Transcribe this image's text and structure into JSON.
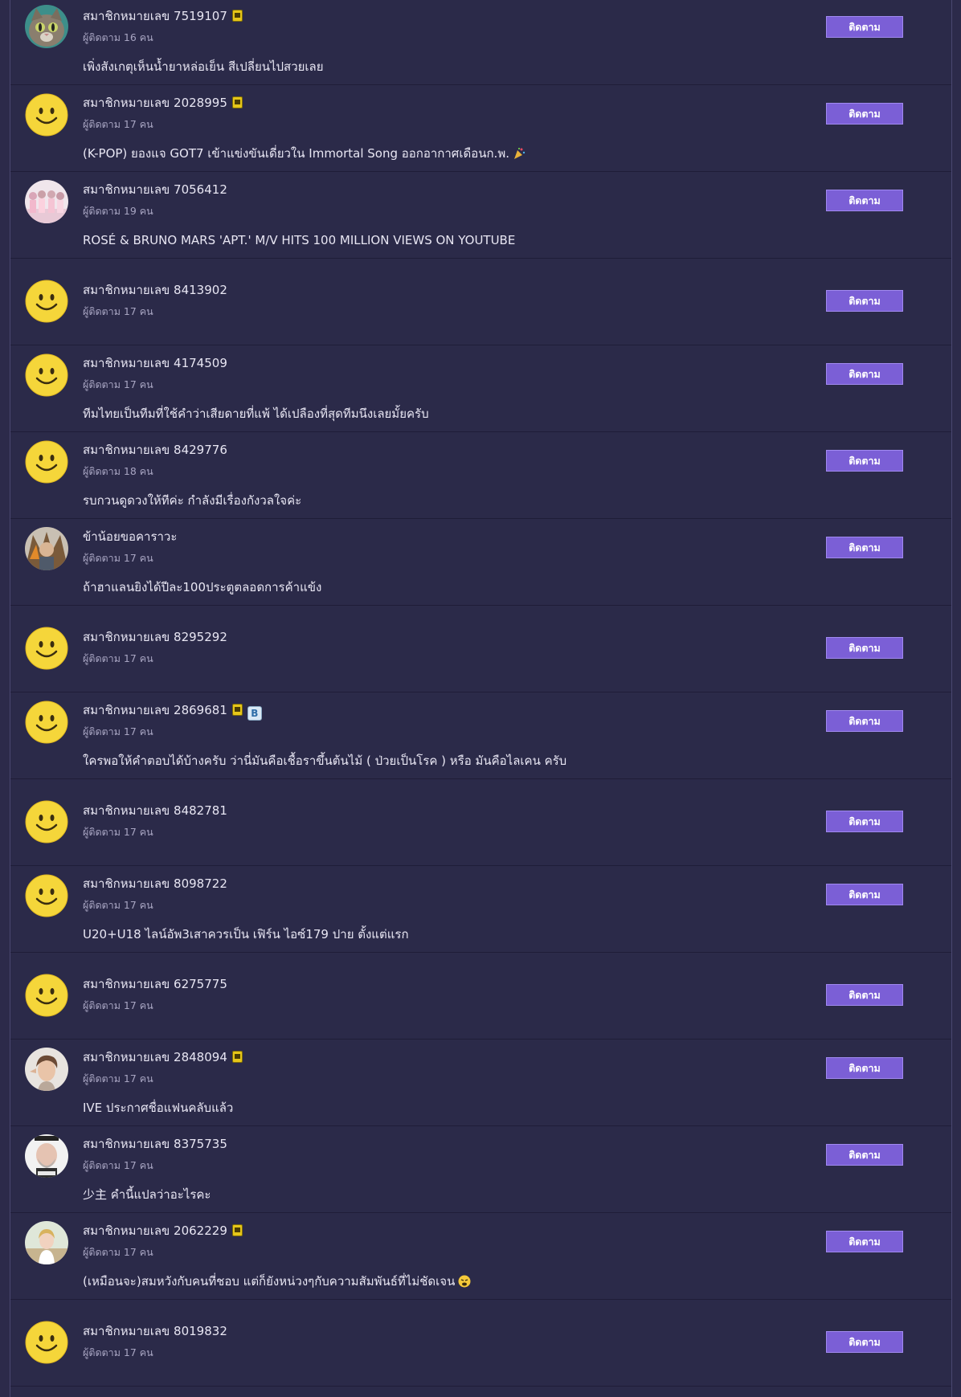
{
  "follow_label": "ติดตาม",
  "members": [
    {
      "name": "สมาชิกหมายเลข 7519107",
      "followers": "ผู้ติดตาม 16 คน",
      "post": "เพิ่งสังเกตุเห็นน้ำยาหล่อเย็น สีเปลี่ยนไปสวยเลย",
      "avatar": "cat-avatar",
      "badges": [
        "phone-badge"
      ]
    },
    {
      "name": "สมาชิกหมายเลข 2028995",
      "followers": "ผู้ติดตาม 17 คน",
      "post": "(K-POP) ยองแจ GOT7 เข้าแข่งขันเดี่ยวใน Immortal Song ออกอากาศเดือนก.พ.",
      "post_emoji": "party-popper",
      "avatar": "smiley-avatar",
      "badges": [
        "phone-badge"
      ]
    },
    {
      "name": "สมาชิกหมายเลข 7056412",
      "followers": "ผู้ติดตาม 19 คน",
      "post": "ROSÉ & BRUNO MARS 'APT.' M/V HITS 100 MILLION VIEWS ON YOUTUBE",
      "avatar": "group-photo-avatar",
      "badges": []
    },
    {
      "name": "สมาชิกหมายเลข 8413902",
      "followers": "ผู้ติดตาม 17 คน",
      "post": "",
      "avatar": "smiley-avatar",
      "badges": []
    },
    {
      "name": "สมาชิกหมายเลข 4174509",
      "followers": "ผู้ติดตาม 17 คน",
      "post": "ทีมไทยเป็นทีมที่ใช้คำว่าเสียดายที่แพ้ ได้เปลืองที่สุดทีมนึงเลยมั้ยครับ",
      "avatar": "smiley-avatar",
      "badges": []
    },
    {
      "name": "สมาชิกหมายเลข 8429776",
      "followers": "ผู้ติดตาม 18 คน",
      "post": "รบกวนดูดวงให้ทีค่ะ กำลังมีเรื่องกังวลใจค่ะ",
      "avatar": "smiley-avatar",
      "badges": []
    },
    {
      "name": "ข้าน้อยขอคาราวะ",
      "followers": "ผู้ติดตาม 17 คน",
      "post": "ถ้าฮาแลนยิงได้ปีละ100ประตูตลอดการค้าแข้ง",
      "avatar": "warrior-avatar",
      "badges": []
    },
    {
      "name": "สมาชิกหมายเลข 8295292",
      "followers": "ผู้ติดตาม 17 คน",
      "post": "",
      "avatar": "smiley-avatar",
      "badges": []
    },
    {
      "name": "สมาชิกหมายเลข 2869681",
      "followers": "ผู้ติดตาม 17 คน",
      "post": "ใครพอให้คำตอบได้บ้างครับ ว่านี่มันคือเชื้อราขึ้นต้นไม้ ( ป่วยเป็นโรค ) หรือ มันคือไลเคน ครับ",
      "avatar": "smiley-avatar",
      "badges": [
        "phone-badge",
        "blog-badge"
      ]
    },
    {
      "name": "สมาชิกหมายเลข 8482781",
      "followers": "ผู้ติดตาม 17 คน",
      "post": "",
      "avatar": "smiley-avatar",
      "badges": []
    },
    {
      "name": "สมาชิกหมายเลข 8098722",
      "followers": "ผู้ติดตาม 17 คน",
      "post": "U20+U18 ไลน์อัพ3เสาควรเป็น เฟิร์น ไอซ์179 ปาย ตั้งแต่แรก",
      "avatar": "smiley-avatar",
      "badges": []
    },
    {
      "name": "สมาชิกหมายเลข 6275775",
      "followers": "ผู้ติดตาม 17 คน",
      "post": "",
      "avatar": "smiley-avatar",
      "badges": []
    },
    {
      "name": "สมาชิกหมายเลข 2848094",
      "followers": "ผู้ติดตาม 17 คน",
      "post": "IVE ประกาศชื่อแฟนคลับแล้ว",
      "avatar": "portrait-avatar",
      "badges": [
        "phone-badge"
      ]
    },
    {
      "name": "สมาชิกหมายเลข 8375735",
      "followers": "ผู้ติดตาม 17 คน",
      "post": "少主 คำนี้แปลว่าอะไรคะ",
      "avatar": "bald-man-avatar",
      "badges": []
    },
    {
      "name": "สมาชิกหมายเลข 2062229",
      "followers": "ผู้ติดตาม 17 คน",
      "post": "(เหมือนจะ)สมหวังกับคนที่ชอบ แต่ก็ยังหน่วงๆกับความสัมพันธ์ที่ไม่ชัดเจน",
      "post_emoji": "weary-face",
      "avatar": "girl-avatar",
      "badges": [
        "phone-badge"
      ]
    },
    {
      "name": "สมาชิกหมายเลข 8019832",
      "followers": "ผู้ติดตาม 17 คน",
      "post": "",
      "avatar": "smiley-avatar",
      "badges": []
    }
  ],
  "badge_blog_letter": "B"
}
